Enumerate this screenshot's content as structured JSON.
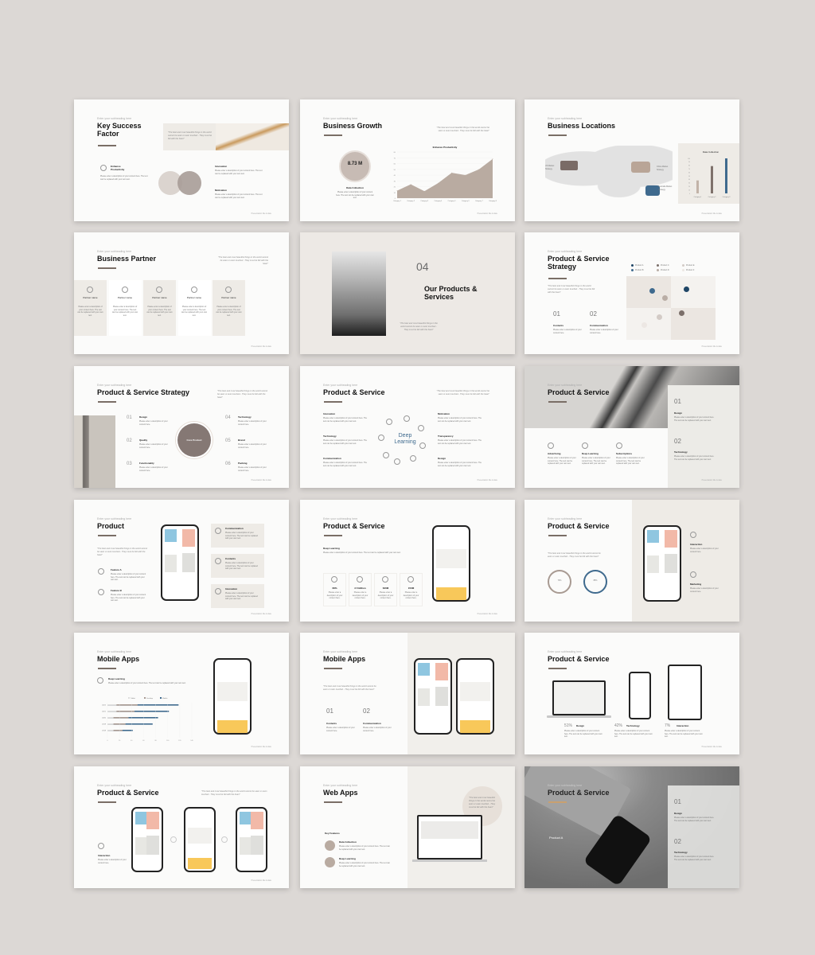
{
  "common": {
    "subtitle": "Enter your subheading here",
    "footer": "Presentation title & date",
    "quote": "\"The best and most beautiful things in the world cannot be seen or even touched - They must be felt with the heart\"",
    "desc_short": "Please enter a description of your content here.",
    "desc_long": "Please enter a description of your content here. The text can be replaced with your own text."
  },
  "slides": [
    {
      "title": "Key Success Factor",
      "items": [
        "Enhance Productivity",
        "Innovation",
        "Motivation"
      ]
    },
    {
      "title": "Business Growth",
      "stat": "8.73 M",
      "stat_label": "Data Collection",
      "chart_title": "Enhance Productivity"
    },
    {
      "title": "Business Locations",
      "labels": [
        "US Market Strategy",
        "China Market Strategy",
        "Australia Market Strategy"
      ],
      "chart_title": "Data Collection"
    },
    {
      "title": "Business Partner",
      "partner": "Partner name"
    },
    {
      "number": "04",
      "title": "Our Products & Services"
    },
    {
      "title": "Product & Service Strategy",
      "items": [
        {
          "n": "01",
          "label": "Contents"
        },
        {
          "n": "02",
          "label": "Communication"
        }
      ],
      "legend": [
        "Product A",
        "Product B",
        "Product C",
        "Product D",
        "Product E",
        "Product F"
      ]
    },
    {
      "title": "Product & Service Strategy",
      "core": "Core Product",
      "items": [
        {
          "n": "01",
          "label": "Design"
        },
        {
          "n": "02",
          "label": "Quality"
        },
        {
          "n": "03",
          "label": "Functionality"
        },
        {
          "n": "04",
          "label": "Technology"
        },
        {
          "n": "05",
          "label": "Brand"
        },
        {
          "n": "06",
          "label": "Packing"
        }
      ]
    },
    {
      "title": "Product & Service",
      "center": "Deep Learning",
      "left": [
        "Innovation",
        "Technology",
        "Communication"
      ],
      "right": [
        "Motivation",
        "Transparency",
        "Design"
      ]
    },
    {
      "title": "Product & Service",
      "items": [
        {
          "n": "01",
          "label": "Design"
        },
        {
          "n": "02",
          "label": "Technology"
        }
      ],
      "features": [
        "Advertising",
        "Deep Learning",
        "Subscriptions"
      ]
    },
    {
      "title": "Product",
      "features": [
        "Feature A",
        "Feature B"
      ],
      "cards": [
        "Communication",
        "Contents",
        "Innovation"
      ]
    },
    {
      "title": "Product & Service",
      "heading": "Deep Learning",
      "stats": [
        "68%",
        "2.5 Billion",
        "630M",
        "150M"
      ]
    },
    {
      "title": "Product & Service",
      "rings": [
        "73%",
        "85%"
      ],
      "side": [
        "Interaction",
        "Marketing"
      ]
    },
    {
      "title": "Mobile Apps",
      "heading": "Deep Learning",
      "legend": [
        "Tablet",
        "Desktop",
        "Mobile"
      ],
      "years": [
        "2022",
        "2021",
        "2020",
        "2019",
        "2018"
      ],
      "ticks": [
        "0",
        "20",
        "40",
        "60",
        "80",
        "100",
        "120",
        "140"
      ]
    },
    {
      "title": "Mobile Apps",
      "items": [
        {
          "n": "01",
          "label": "Contents"
        },
        {
          "n": "02",
          "label": "Communication"
        }
      ]
    },
    {
      "title": "Product & Service",
      "stats": [
        {
          "v": "51%",
          "label": "Design"
        },
        {
          "v": "42%",
          "label": "Technology"
        },
        {
          "v": "7%",
          "label": "Interaction"
        }
      ]
    },
    {
      "title": "Product & Service",
      "feature": "Interaction"
    },
    {
      "title": "Web Apps",
      "heading": "Key Features",
      "items": [
        "Data Collection",
        "Deep Learning"
      ]
    },
    {
      "title": "Product & Service",
      "label": "Product A",
      "items": [
        {
          "n": "01",
          "label": "Design"
        },
        {
          "n": "02",
          "label": "Technology"
        }
      ]
    }
  ],
  "chart_data": [
    {
      "type": "area",
      "title": "Enhance Productivity",
      "categories": [
        "Category 1",
        "Category 2",
        "Category 3",
        "Category 4",
        "Category 5",
        "Category 6",
        "Category 7",
        "Category 8"
      ],
      "values": [
        13,
        24,
        12,
        26,
        44,
        40,
        50,
        68
      ],
      "ylim": [
        0,
        80
      ],
      "color": "#b9aba1"
    },
    {
      "type": "bar",
      "title": "Data Collection",
      "categories": [
        "Category 1",
        "Category 2",
        "Category 3"
      ],
      "values": [
        37,
        78,
        100
      ],
      "ylim": [
        0,
        100
      ],
      "colors": [
        "#c2b3a8",
        "#7e716b",
        "#3f6a8e"
      ]
    },
    {
      "type": "bar",
      "orientation": "horizontal",
      "title": "Mobile Apps",
      "categories": [
        "2022",
        "2021",
        "2020",
        "2019",
        "2018"
      ],
      "series": [
        {
          "name": "Tablet",
          "values": [
            15,
            15,
            10,
            10,
            10
          ],
          "color": "#ddd"
        },
        {
          "name": "Desktop",
          "values": [
            50,
            45,
            35,
            30,
            25
          ],
          "color": "#a89a92"
        },
        {
          "name": "Mobile",
          "values": [
            118,
            102,
            84,
            75,
            42
          ],
          "color": "#3f6a8e"
        }
      ],
      "xlim": [
        0,
        140
      ]
    }
  ]
}
